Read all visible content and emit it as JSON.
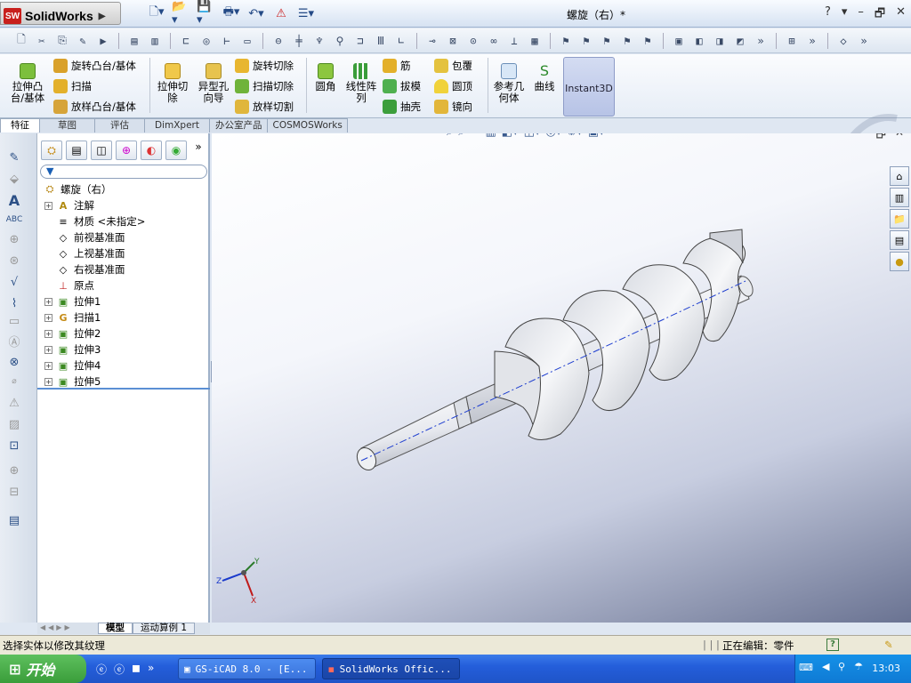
{
  "app": {
    "name": "SolidWorks",
    "doc_title": "螺旋（右）*"
  },
  "window_controls": [
    "?",
    "▾",
    "–",
    "🗗",
    "✕"
  ],
  "ribbon": {
    "extrude_boss": "拉伸凸\n台/基体",
    "revolve_boss": "旋转凸台/基体",
    "sweep": "扫描",
    "loft_boss": "放样凸台/基体",
    "extrude_cut": "拉伸切\n除",
    "hole_wizard": "异型孔\n向导",
    "revolve_cut": "旋转切除",
    "sweep_cut": "扫描切除",
    "loft_cut": "放样切割",
    "fillet": "圆角",
    "linear_pattern": "线性阵\n列",
    "rib": "筋",
    "draft": "拔模",
    "shell": "抽壳",
    "wrap": "包覆",
    "dome": "圆顶",
    "mirror": "镜向",
    "ref_geometry": "参考几\n何体",
    "curves": "曲线",
    "instant3d": "Instant3D"
  },
  "command_tabs": [
    "特征",
    "草图",
    "评估",
    "DimXpert",
    "办公室产品",
    "COSMOSWorks"
  ],
  "feature_tree": {
    "root": "螺旋（右）",
    "items": [
      {
        "label": "注解",
        "expand": true,
        "icon": "A"
      },
      {
        "label": "材质 <未指定>",
        "expand": false,
        "icon": "≡"
      },
      {
        "label": "前视基准面",
        "expand": false,
        "icon": "◇"
      },
      {
        "label": "上视基准面",
        "expand": false,
        "icon": "◇"
      },
      {
        "label": "右视基准面",
        "expand": false,
        "icon": "◇"
      },
      {
        "label": "原点",
        "expand": false,
        "icon": "⊥"
      },
      {
        "label": "拉伸1",
        "expand": true,
        "icon": "▣"
      },
      {
        "label": "扫描1",
        "expand": true,
        "icon": "G"
      },
      {
        "label": "拉伸2",
        "expand": true,
        "icon": "▣"
      },
      {
        "label": "拉伸3",
        "expand": true,
        "icon": "▣"
      },
      {
        "label": "拉伸4",
        "expand": true,
        "icon": "▣"
      },
      {
        "label": "拉伸5",
        "expand": true,
        "icon": "▣"
      }
    ]
  },
  "bottom_tabs": {
    "model": "模型",
    "motion": "运动算例 1"
  },
  "status": {
    "left": "选择实体以修改其纹理",
    "right": "正在编辑：零件"
  },
  "taskbar": {
    "start": "开始",
    "task1": "GS-iCAD 8.0 - [E...",
    "task2": "SolidWorks Offic...",
    "time": "13:03"
  },
  "axes": {
    "x": "X",
    "y": "Y",
    "z": "Z"
  },
  "colors": {
    "accent": "#245edb",
    "part": "#e8eaee"
  }
}
